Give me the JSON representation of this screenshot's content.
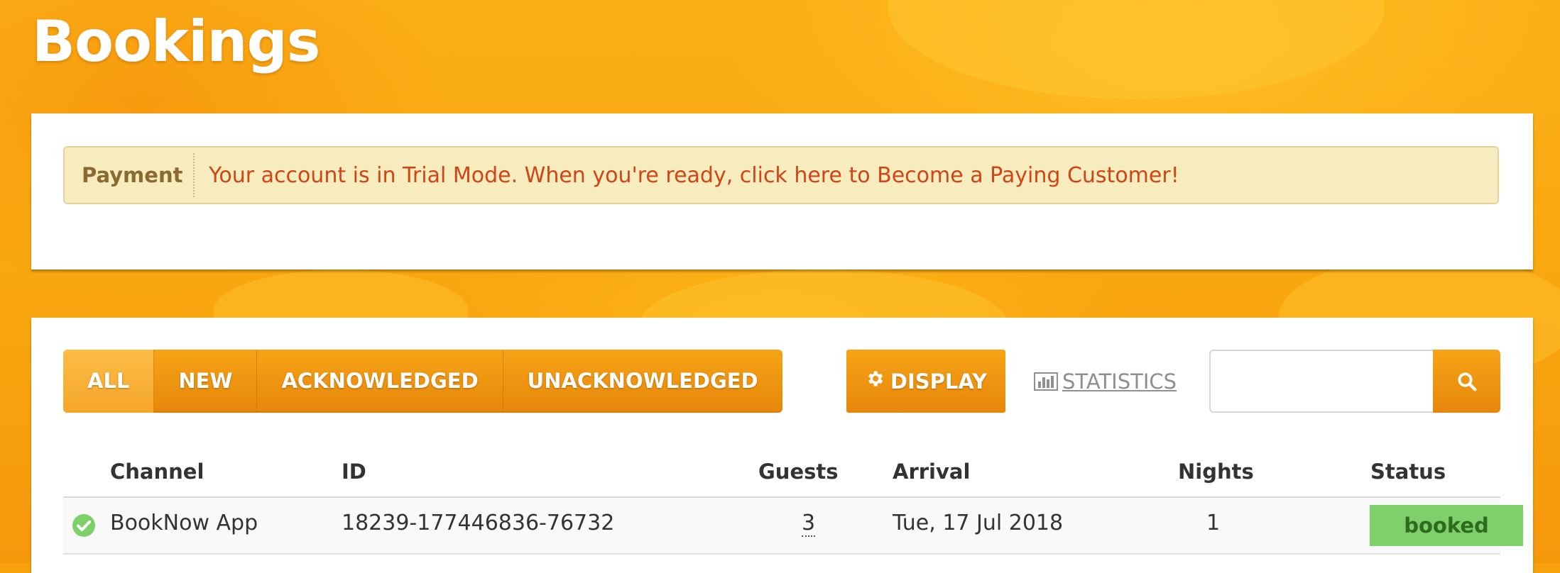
{
  "page": {
    "title": "Bookings"
  },
  "alert": {
    "label": "Payment",
    "message": "Your account is in Trial Mode. When you're ready, click here to Become a Paying Customer!"
  },
  "filters": {
    "tabs": [
      {
        "label": "ALL",
        "active": true
      },
      {
        "label": "NEW",
        "active": false
      },
      {
        "label": "ACKNOWLEDGED",
        "active": false
      },
      {
        "label": "UNACKNOWLEDGED",
        "active": false
      }
    ],
    "display_label": "DISPLAY",
    "statistics_label": "STATISTICS",
    "search_placeholder": ""
  },
  "table": {
    "columns": {
      "channel": "Channel",
      "id": "ID",
      "guests": "Guests",
      "arrival": "Arrival",
      "nights": "Nights",
      "status": "Status"
    },
    "rows": [
      {
        "channel": "BookNow App",
        "id": "18239-177446836-76732",
        "guests": "3",
        "arrival": "Tue, 17 Jul 2018",
        "nights": "1",
        "status": "booked"
      }
    ]
  },
  "colors": {
    "brand_orange": "#f7a10c",
    "alert_text": "#d24414",
    "status_booked": "#7ed06b"
  },
  "icons": {
    "display": "gear-icon",
    "statistics": "bar-chart-icon",
    "search": "search-icon",
    "row_status": "check-circle-icon"
  }
}
